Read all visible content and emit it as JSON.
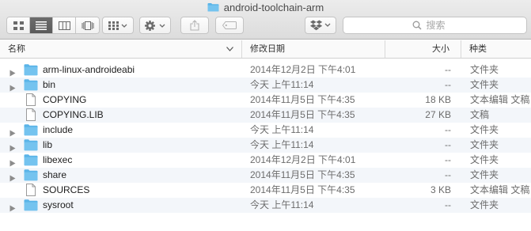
{
  "window": {
    "title": "android-toolchain-arm"
  },
  "toolbar": {
    "views": [
      "icon-view",
      "list-view",
      "column-view",
      "cover-flow-view"
    ],
    "active_view": "list-view",
    "search": {
      "placeholder": "搜索"
    }
  },
  "columns": {
    "name": "名称",
    "date": "修改日期",
    "size": "大小",
    "kind": "种类"
  },
  "files": [
    {
      "name": "arm-linux-androideabi",
      "date": "2014年12月2日 下午4:01",
      "size": "--",
      "kind": "文件夹",
      "type": "folder"
    },
    {
      "name": "bin",
      "date": "今天 上午11:14",
      "size": "--",
      "kind": "文件夹",
      "type": "folder"
    },
    {
      "name": "COPYING",
      "date": "2014年11月5日 下午4:35",
      "size": "18 KB",
      "kind": "文本编辑 文稿",
      "type": "document"
    },
    {
      "name": "COPYING.LIB",
      "date": "2014年11月5日 下午4:35",
      "size": "27 KB",
      "kind": "文稿",
      "type": "document"
    },
    {
      "name": "include",
      "date": "今天 上午11:14",
      "size": "--",
      "kind": "文件夹",
      "type": "folder"
    },
    {
      "name": "lib",
      "date": "今天 上午11:14",
      "size": "--",
      "kind": "文件夹",
      "type": "folder"
    },
    {
      "name": "libexec",
      "date": "2014年12月2日 下午4:01",
      "size": "--",
      "kind": "文件夹",
      "type": "folder"
    },
    {
      "name": "share",
      "date": "2014年11月5日 下午4:35",
      "size": "--",
      "kind": "文件夹",
      "type": "folder"
    },
    {
      "name": "SOURCES",
      "date": "2014年11月5日 下午4:35",
      "size": "3 KB",
      "kind": "文本编辑 文稿",
      "type": "document"
    },
    {
      "name": "sysroot",
      "date": "今天 上午11:14",
      "size": "--",
      "kind": "文件夹",
      "type": "folder"
    }
  ],
  "colors": {
    "folder": "#5ab4e8",
    "active_segment": "#626262",
    "row_stripe": "#f3f6fa"
  }
}
